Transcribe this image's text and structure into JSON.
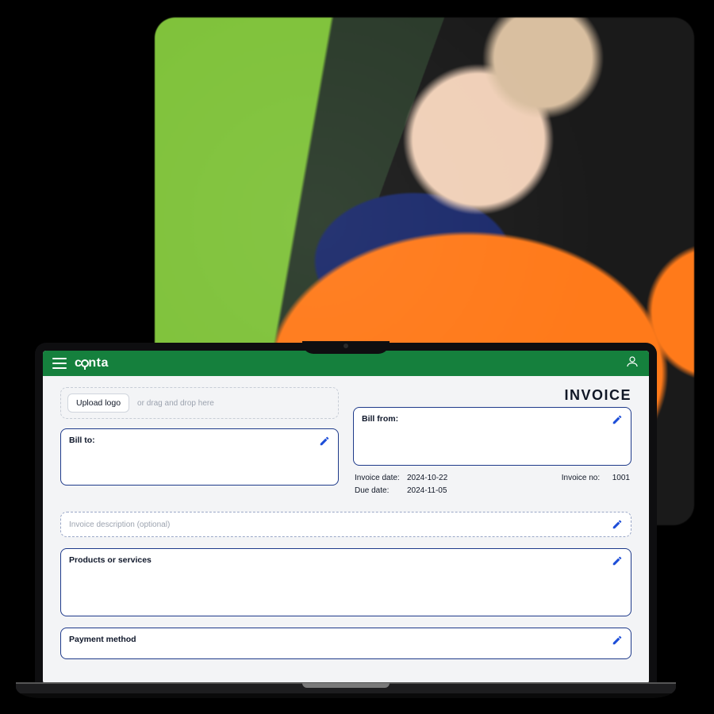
{
  "brand": "conta",
  "doc_title": "INVOICE",
  "upload": {
    "button": "Upload logo",
    "hint": "or drag and drop here"
  },
  "bill_to": {
    "label": "Bill to:"
  },
  "bill_from": {
    "label": "Bill from:"
  },
  "dates": {
    "invoice_date_label": "Invoice date:",
    "invoice_date": "2024-10-22",
    "due_date_label": "Due date:",
    "due_date": "2024-11-05"
  },
  "invoice_no": {
    "label": "Invoice no:",
    "value": "1001"
  },
  "description_placeholder": "Invoice description (optional)",
  "products": {
    "label": "Products or services"
  },
  "payment": {
    "label": "Payment method"
  }
}
